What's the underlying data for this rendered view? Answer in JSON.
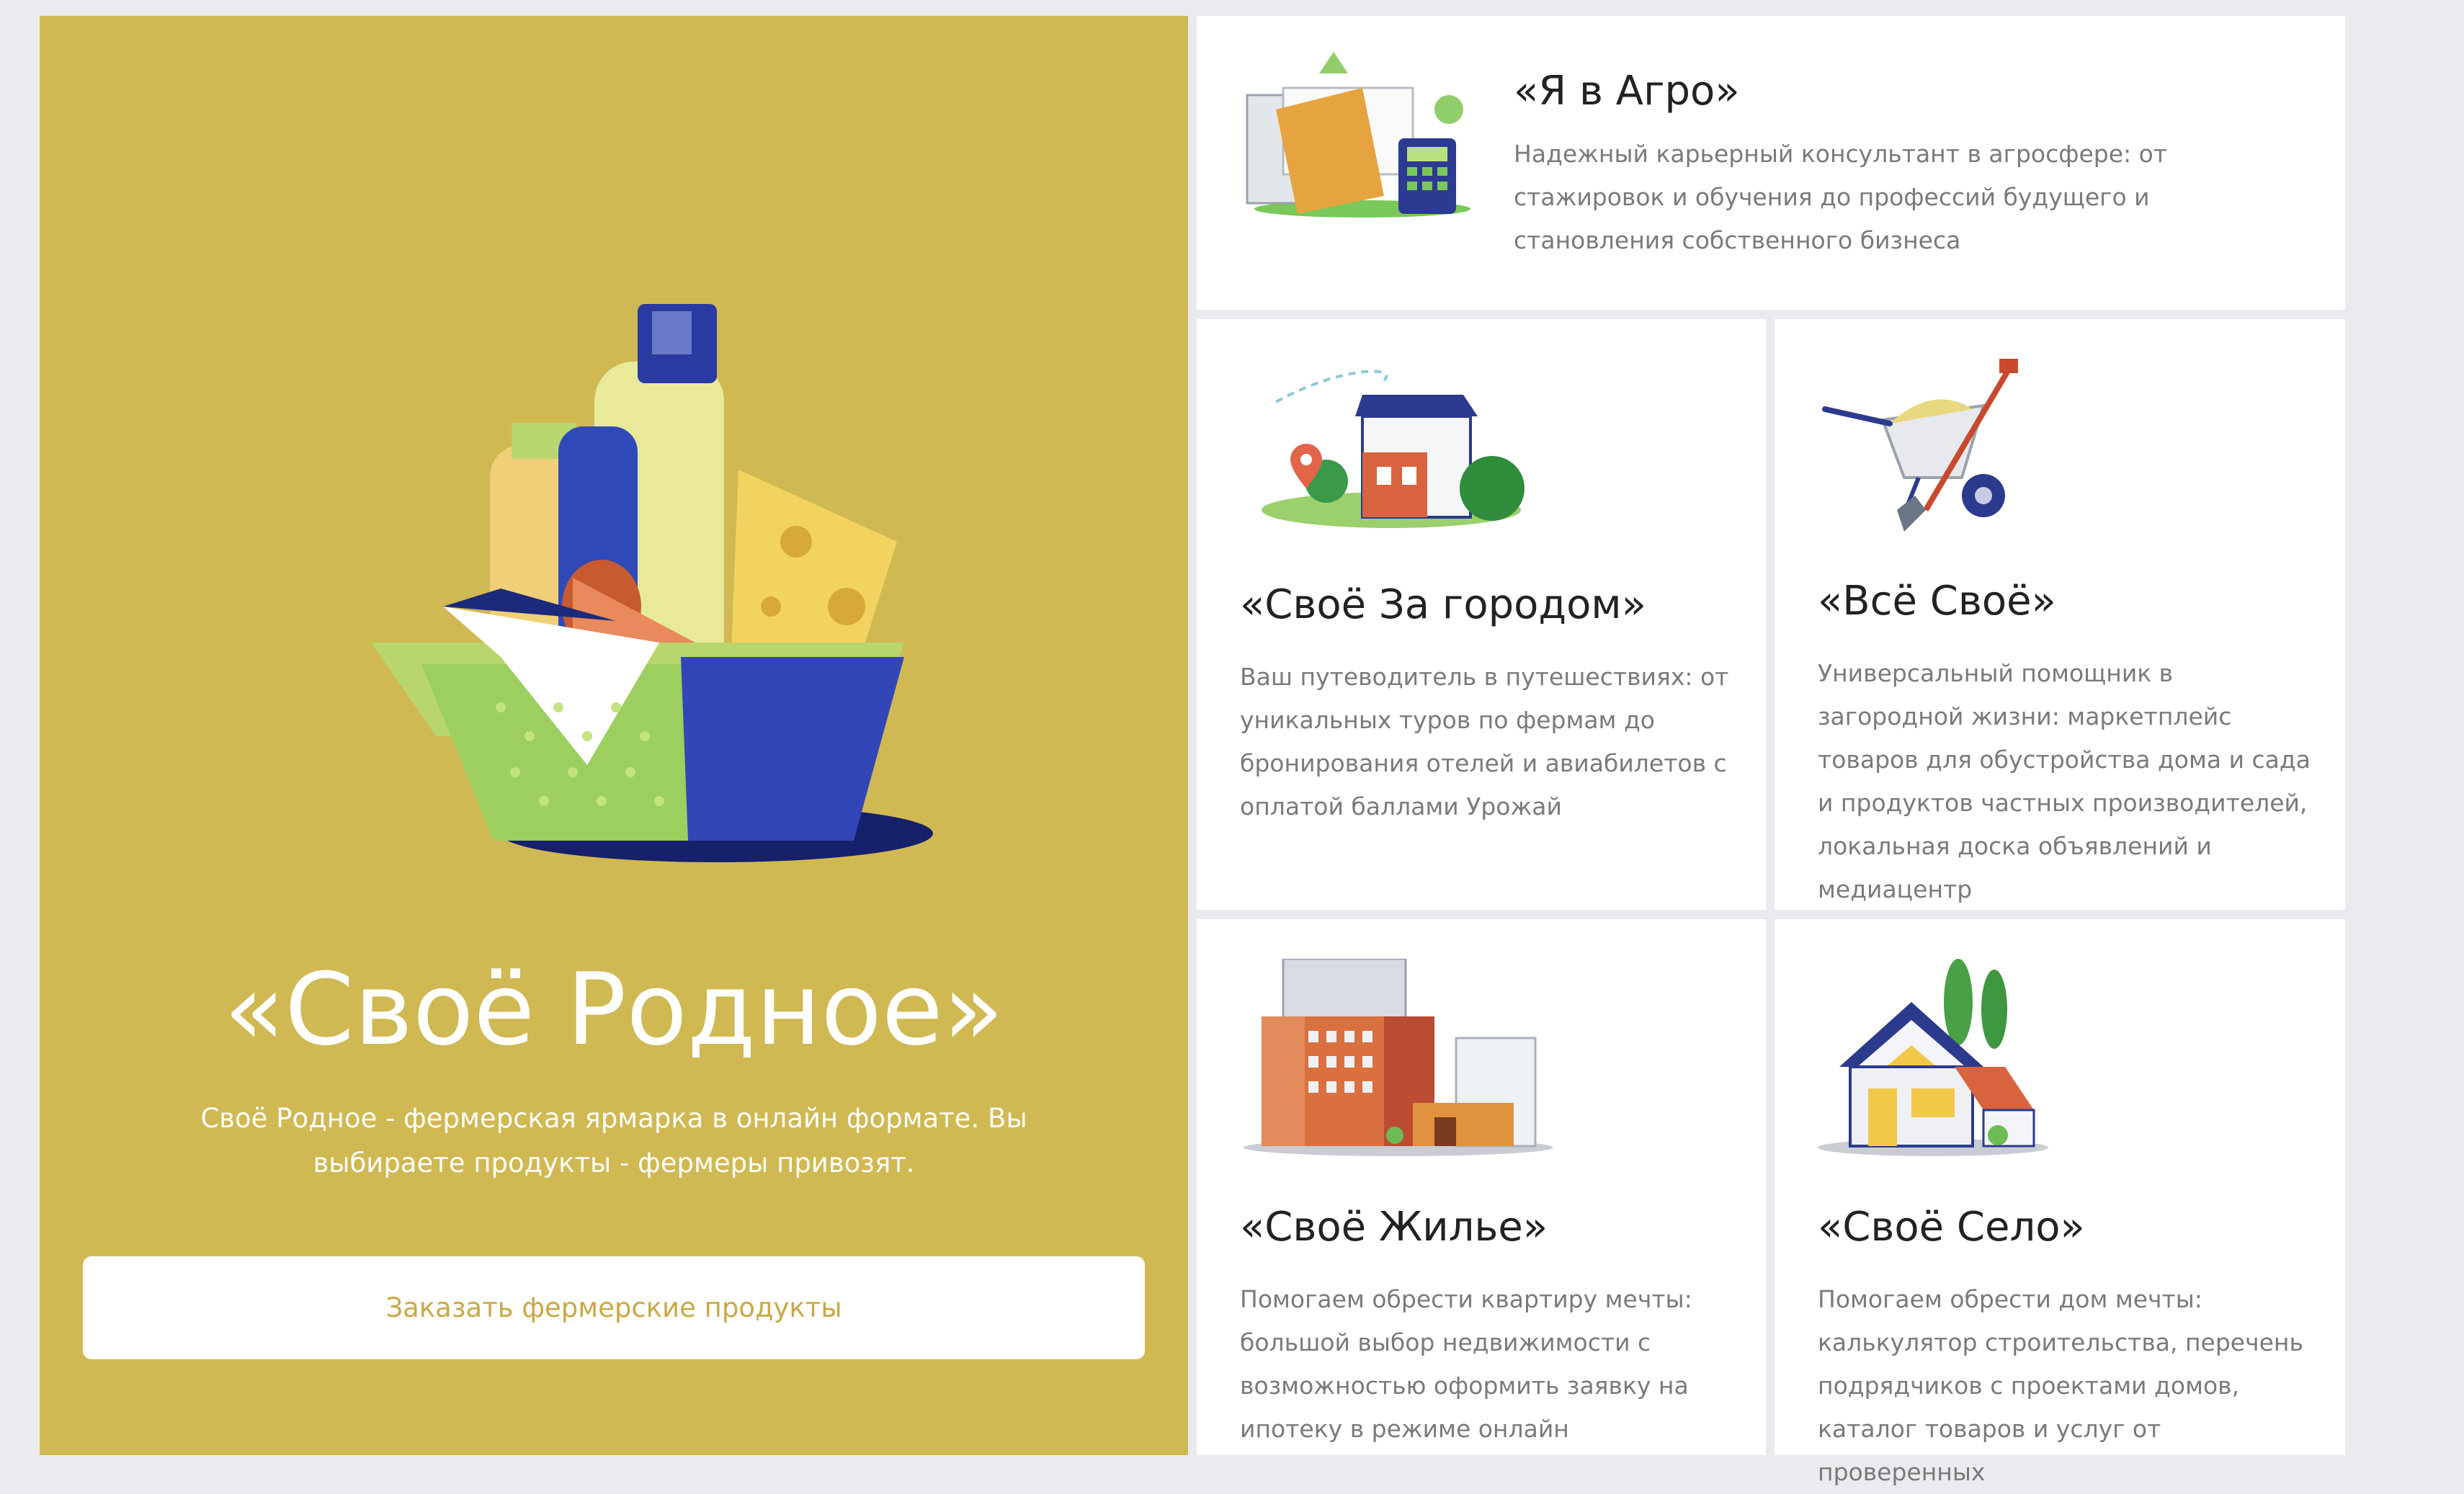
{
  "hero": {
    "title": "«Своё Родное»",
    "description": "Своё Родное - фермерская ярмарка в онлайн формате. Вы выбираете продукты - фермеры привозят.",
    "button_label": "Заказать фермерские продукты"
  },
  "cards": [
    {
      "title": "«Я в Агро»",
      "description": "Надежный карьерный консультант в агросфере: от стажировок и обучения до профессий будущего и становления собственного бизнеса",
      "icon": "documents-calculator-icon"
    },
    {
      "title": "«Своё За городом»",
      "description": "Ваш путеводитель в путешествиях: от уникальных туров по фермам до бронирования отелей и авиабилетов с оплатой баллами Урожай",
      "icon": "country-house-location-icon"
    },
    {
      "title": "«Всё Своё»",
      "description": "Универсальный помощник в загородной жизни: маркетплейс товаров для обустройства дома и сада и продуктов частных производителей, локальная доска объявлений и медиацентр",
      "icon": "wheelbarrow-shovel-icon"
    },
    {
      "title": "«Своё Жилье»",
      "description": "Помогаем обрести квартиру мечты: большой выбор недвижимости с возможностью оформить заявку на ипотеку в режиме онлайн",
      "icon": "apartment-buildings-icon"
    },
    {
      "title": "«Своё Село»",
      "description": "Помогаем обрести дом мечты: калькулятор строительства, перечень подрядчиков с проектами домов, каталог товаров и услуг от проверенных",
      "icon": "village-house-icon"
    }
  ],
  "colors": {
    "hero_background": "#d0b852",
    "button_text": "#c9a845",
    "page_background": "#e9ebef"
  }
}
